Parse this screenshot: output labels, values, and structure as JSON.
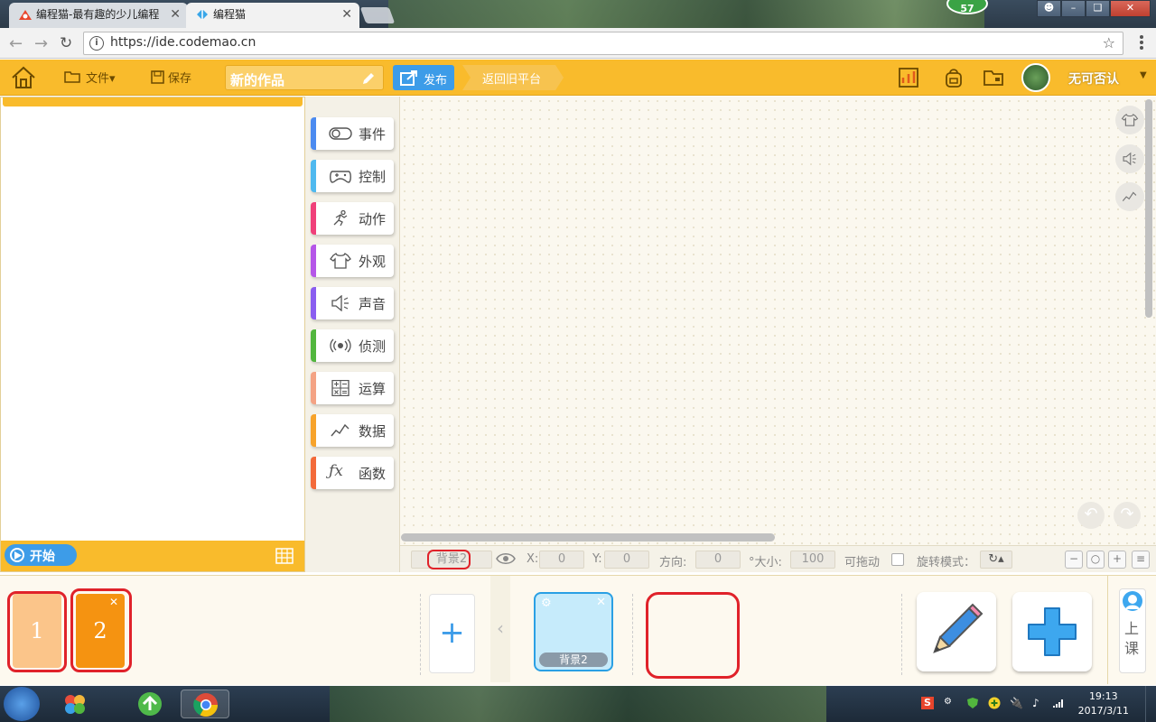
{
  "browser": {
    "tabs": [
      {
        "title": "编程猫-最有趣的少儿编程"
      },
      {
        "title": "编程猫"
      }
    ],
    "badge_count": "57",
    "url": "https://ide.codemao.cn"
  },
  "header": {
    "file_menu": "文件▾",
    "save": "保存",
    "project_title": "新的作品",
    "publish": "发布",
    "back_old": "返回旧平台",
    "username": "无可否认"
  },
  "stage": {
    "start": "开始"
  },
  "categories": [
    {
      "label": "事件",
      "color": "#4c8bf0",
      "icon": "toggle-icon"
    },
    {
      "label": "控制",
      "color": "#4fb9ef",
      "icon": "gamepad-icon"
    },
    {
      "label": "动作",
      "color": "#f0407a",
      "icon": "running-icon"
    },
    {
      "label": "外观",
      "color": "#b556e8",
      "icon": "shirt-icon"
    },
    {
      "label": "声音",
      "color": "#8a5ef0",
      "icon": "speaker-icon"
    },
    {
      "label": "侦测",
      "color": "#52b63e",
      "icon": "sensor-icon"
    },
    {
      "label": "运算",
      "color": "#f4a384",
      "icon": "calculator-icon"
    },
    {
      "label": "数据",
      "color": "#f7a32b",
      "icon": "chart-icon"
    },
    {
      "label": "函数",
      "color": "#f36a3a",
      "icon": "function-icon"
    }
  ],
  "props": {
    "sprite_name": "背景2",
    "x_label": "X:",
    "x_value": "0",
    "y_label": "Y:",
    "y_value": "0",
    "direction_label": "方向:",
    "direction_value": "0",
    "size_label": "°大小:",
    "size_value": "100",
    "draggable_label": "可拖动",
    "rotation_label": "旋转模式："
  },
  "scenes": [
    {
      "number": "1",
      "color": "#fbc58a"
    },
    {
      "number": "2",
      "color": "#f59311"
    }
  ],
  "sprites": [
    {
      "name": "背景2"
    }
  ],
  "class_button": "上课",
  "taskbar": {
    "time": "19:13",
    "date": "2017/3/11"
  }
}
